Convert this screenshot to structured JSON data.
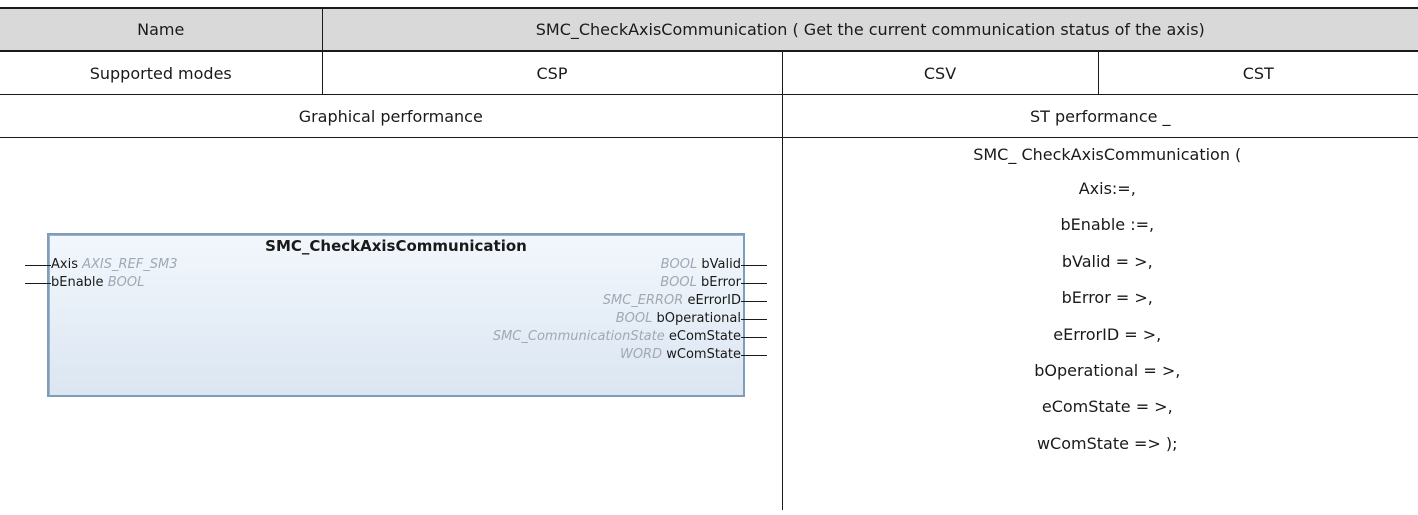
{
  "header": {
    "name_label": "Name",
    "name_value": "SMC_CheckAxisCommunication ( Get the current communication status of the axis)"
  },
  "modes": {
    "label": "Supported modes",
    "values": [
      "CSP",
      "CSV",
      "CST"
    ]
  },
  "performance": {
    "graphical_label": "Graphical performance",
    "st_label": "ST performance _"
  },
  "function_block": {
    "title": "SMC_CheckAxisCommunication",
    "inputs": [
      {
        "name": "Axis",
        "type": "AXIS_REF_SM3"
      },
      {
        "name": "bEnable",
        "type": "BOOL"
      }
    ],
    "outputs": [
      {
        "name": "bValid",
        "type": "BOOL"
      },
      {
        "name": "bError",
        "type": "BOOL"
      },
      {
        "name": "eErrorID",
        "type": "SMC_ERROR"
      },
      {
        "name": "bOperational",
        "type": "BOOL"
      },
      {
        "name": "eComState",
        "type": "SMC_CommunicationState"
      },
      {
        "name": "wComState",
        "type": "WORD"
      }
    ]
  },
  "st_code": [
    "SMC_ CheckAxisCommunication (",
    "Axis:=,",
    "bEnable :=,",
    "bValid = >,",
    "bError = >,",
    "eErrorID = >,",
    "bOperational = >,",
    "eComState = >,",
    "wComState => );"
  ]
}
